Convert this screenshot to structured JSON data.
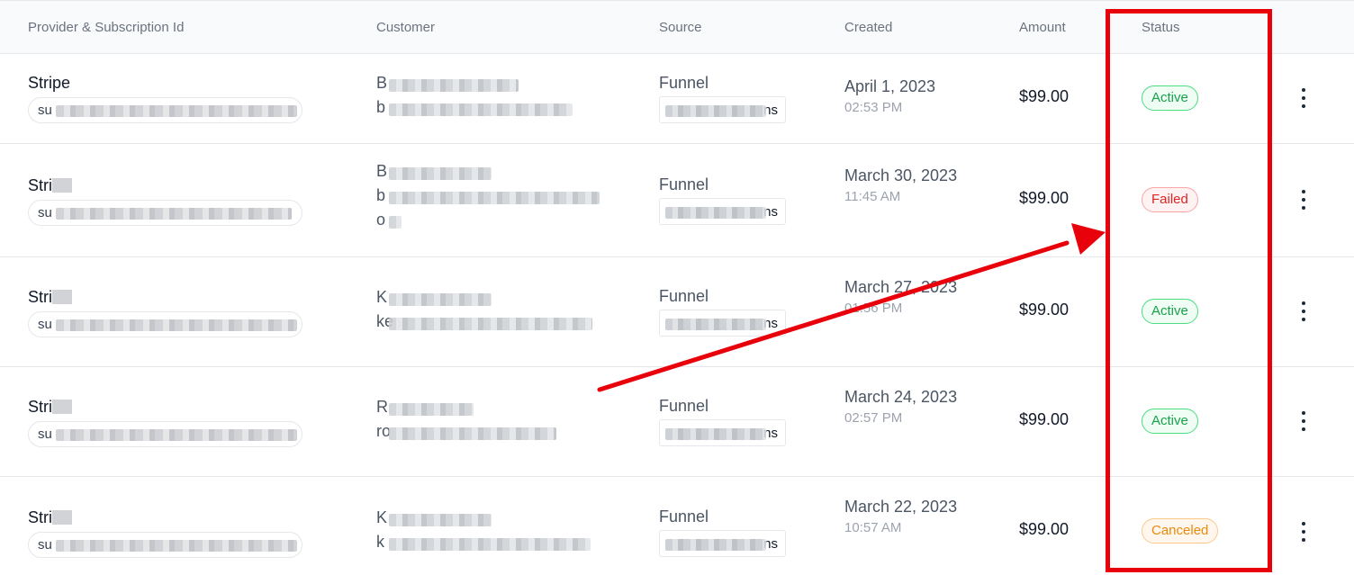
{
  "header": {
    "provider": "Provider & Subscription Id",
    "customer": "Customer",
    "source": "Source",
    "created": "Created",
    "amount": "Amount",
    "status": "Status"
  },
  "rows": [
    {
      "provider": "Stripe",
      "sub_prefix": "su",
      "cust1_prefix": "B",
      "cust2_prefix": "b",
      "cust3_prefix": "",
      "source": "Funnel",
      "source_suffix": "ns",
      "date": "April 1, 2023",
      "time": "02:53 PM",
      "amount": "$99.00",
      "status": "Active"
    },
    {
      "provider": "Stri",
      "sub_prefix": "su",
      "cust1_prefix": "B",
      "cust2_prefix": "b",
      "cust3_prefix": "o",
      "source": "Funnel",
      "source_suffix": "ns",
      "date": "March 30, 2023",
      "time": "11:45 AM",
      "amount": "$99.00",
      "status": "Failed"
    },
    {
      "provider": "Stri",
      "sub_prefix": "su",
      "cust1_prefix": "K",
      "cust2_prefix": "ke",
      "cust3_prefix": "",
      "source": "Funnel",
      "source_suffix": "ns",
      "date": "March 27, 2023",
      "time": "01:56 PM",
      "amount": "$99.00",
      "status": "Active"
    },
    {
      "provider": "Stri",
      "sub_prefix": "su",
      "cust1_prefix": "R",
      "cust2_prefix": "ro",
      "cust3_prefix": "",
      "source": "Funnel",
      "source_suffix": "ns",
      "date": "March 24, 2023",
      "time": "02:57 PM",
      "amount": "$99.00",
      "status": "Active"
    },
    {
      "provider": "Stri",
      "sub_prefix": "su",
      "cust1_prefix": "K",
      "cust2_prefix": "k",
      "cust3_prefix": "",
      "source": "Funnel",
      "source_suffix": "ns",
      "date": "March 22, 2023",
      "time": "10:57 AM",
      "amount": "$99.00",
      "status": "Canceled"
    }
  ],
  "colors": {
    "annotation": "#e8000b",
    "active": "#16a34a",
    "failed": "#dc2626",
    "canceled": "#ea8a0c"
  },
  "icons": {
    "row_menu": "kebab-menu-icon"
  }
}
